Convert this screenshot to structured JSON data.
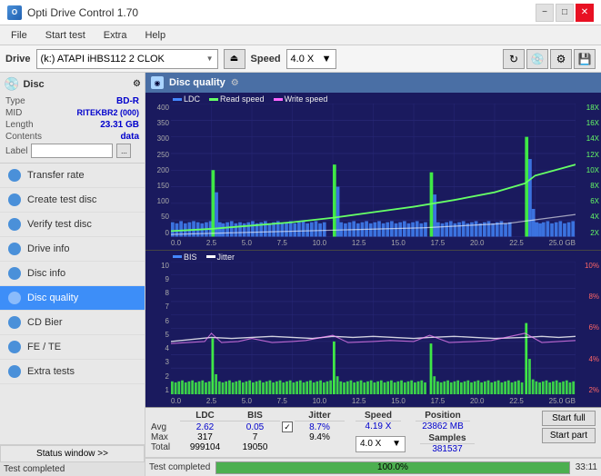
{
  "titlebar": {
    "title": "Opti Drive Control 1.70",
    "min": "−",
    "max": "□",
    "close": "✕"
  },
  "menubar": {
    "items": [
      "File",
      "Start test",
      "Extra",
      "Help"
    ]
  },
  "toolbar": {
    "drive_label": "Drive",
    "drive_value": "(k:)  ATAPI iHBS112  2 CLOK",
    "speed_label": "Speed",
    "speed_value": "4.0 X"
  },
  "sidebar": {
    "disc_title": "Disc",
    "disc_info": {
      "type_label": "Type",
      "type_value": "BD-R",
      "mid_label": "MID",
      "mid_value": "RITEKBR2 (000)",
      "length_label": "Length",
      "length_value": "23.31 GB",
      "contents_label": "Contents",
      "contents_value": "data",
      "label_label": "Label"
    },
    "nav_items": [
      {
        "id": "transfer-rate",
        "label": "Transfer rate"
      },
      {
        "id": "create-test-disc",
        "label": "Create test disc"
      },
      {
        "id": "verify-test-disc",
        "label": "Verify test disc"
      },
      {
        "id": "drive-info",
        "label": "Drive info"
      },
      {
        "id": "disc-info",
        "label": "Disc info"
      },
      {
        "id": "disc-quality",
        "label": "Disc quality",
        "active": true
      },
      {
        "id": "cd-bier",
        "label": "CD Bier"
      },
      {
        "id": "fe-te",
        "label": "FE / TE"
      },
      {
        "id": "extra-tests",
        "label": "Extra tests"
      }
    ],
    "status_window_btn": "Status window >>",
    "status_text": "Test completed"
  },
  "disc_quality": {
    "title": "Disc quality",
    "legend": {
      "ldc": "LDC",
      "read": "Read speed",
      "write": "Write speed",
      "bis": "BIS",
      "jitter": "Jitter"
    },
    "top_chart": {
      "y_left": [
        "400",
        "350",
        "300",
        "250",
        "200",
        "150",
        "100",
        "50",
        "0"
      ],
      "y_right": [
        "18X",
        "16X",
        "14X",
        "12X",
        "10X",
        "8X",
        "6X",
        "4X",
        "2X"
      ],
      "x_labels": [
        "0.0",
        "2.5",
        "5.0",
        "7.5",
        "10.0",
        "12.5",
        "15.0",
        "17.5",
        "20.0",
        "22.5",
        "25.0 GB"
      ]
    },
    "bottom_chart": {
      "y_left": [
        "10",
        "9",
        "8",
        "7",
        "6",
        "5",
        "4",
        "3",
        "2",
        "1"
      ],
      "y_right": [
        "10%",
        "8%",
        "6%",
        "4%",
        "2%"
      ],
      "x_labels": [
        "0.0",
        "2.5",
        "5.0",
        "7.5",
        "10.0",
        "12.5",
        "15.0",
        "17.5",
        "20.0",
        "22.5",
        "25.0 GB"
      ]
    }
  },
  "stats": {
    "headers": [
      "LDC",
      "BIS",
      "Jitter"
    ],
    "jitter_checked": true,
    "rows": [
      {
        "label": "Avg",
        "ldc": "2.62",
        "bis": "0.05",
        "jitter": "8.7%"
      },
      {
        "label": "Max",
        "ldc": "317",
        "bis": "7",
        "jitter": "9.4%"
      },
      {
        "label": "Total",
        "ldc": "999104",
        "bis": "19050",
        "jitter": ""
      }
    ],
    "speed_header": "Speed",
    "speed_value": "4.19 X",
    "speed_dropdown": "4.0 X",
    "position_header": "Position",
    "position_value": "23862 MB",
    "samples_header": "Samples",
    "samples_value": "381537",
    "start_full_btn": "Start full",
    "start_part_btn": "Start part"
  },
  "statusbar": {
    "progress": "100.0%",
    "progress_pct": 100,
    "time": "33:11",
    "status": "Test completed"
  }
}
